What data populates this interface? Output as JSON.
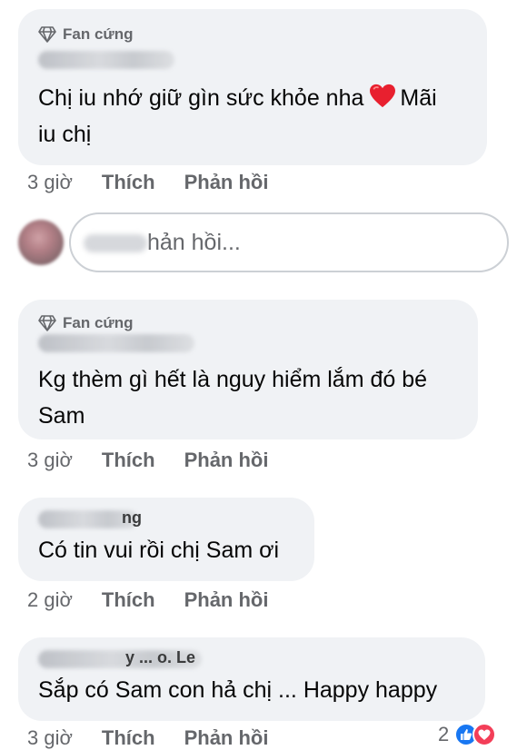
{
  "comments": [
    {
      "badge": "Fan cứng",
      "text_before_heart": "Chị iu nhớ giữ gìn sức khỏe nha",
      "text_after_heart": "Mãi",
      "text_line2": "iu chị",
      "time": "3 giờ",
      "like_label": "Thích",
      "reply_label": "Phản hồi"
    },
    {
      "badge": "Fan cứng",
      "text_line1": "Kg thèm gì hết là nguy hiểm lắm đó bé",
      "text_line2": "Sam",
      "time": "3 giờ",
      "like_label": "Thích",
      "reply_label": "Phản hồi"
    },
    {
      "name_fragment": "ng",
      "text": "Có tin vui rồi chị Sam ơi",
      "time": "2 giờ",
      "like_label": "Thích",
      "reply_label": "Phản hồi"
    },
    {
      "name_fragment": "y ... o. Le",
      "text": "Sắp có Sam con hả chị ... Happy happy",
      "time": "3 giờ",
      "like_label": "Thích",
      "reply_label": "Phản hồi",
      "reaction_count": "2"
    }
  ],
  "reply_box": {
    "placeholder": "hản hồi..."
  },
  "colors": {
    "bubble": "#f0f2f5",
    "secondary_text": "#65676b",
    "like": "#1877f2",
    "love": "#f33e58"
  }
}
